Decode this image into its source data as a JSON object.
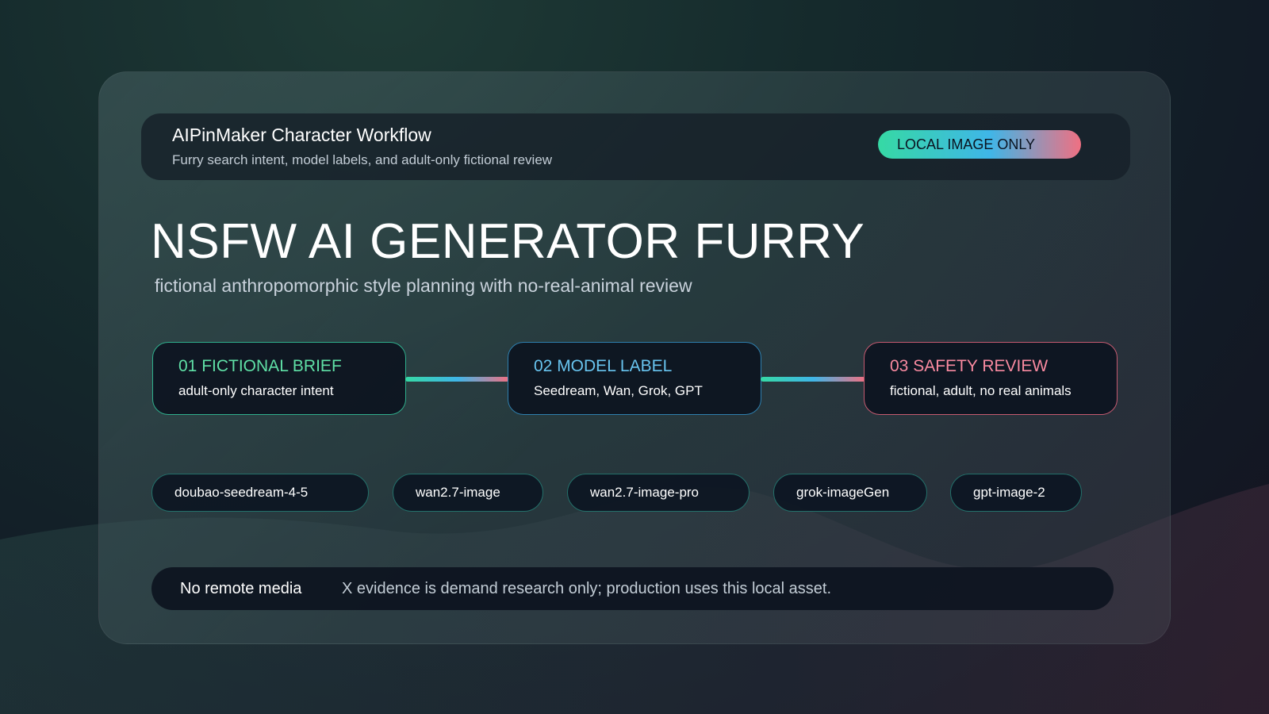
{
  "header": {
    "title": "AIPinMaker Character Workflow",
    "subtitle": "Furry search intent, model labels, and adult-only fictional review",
    "badge": "LOCAL IMAGE ONLY"
  },
  "hero": {
    "title": "NSFW AI GENERATOR FURRY",
    "subtitle": "fictional anthropomorphic style planning with no-real-animal review"
  },
  "steps": [
    {
      "title": "01 FICTIONAL BRIEF",
      "desc": "adult-only character intent"
    },
    {
      "title": "02 MODEL LABEL",
      "desc": "Seedream, Wan, Grok, GPT"
    },
    {
      "title": "03 SAFETY REVIEW",
      "desc": "fictional, adult, no real animals"
    }
  ],
  "models": [
    "doubao-seedream-4-5",
    "wan2.7-image",
    "wan2.7-image-pro",
    "grok-imageGen",
    "gpt-image-2"
  ],
  "footer": {
    "label": "No remote media",
    "text": "X evidence is demand research only; production uses this local asset."
  },
  "colors": {
    "accent_green": "#5fe0a6",
    "accent_blue": "#68c4ef",
    "accent_pink": "#f98aa0",
    "panel_dark": "#0d1420"
  }
}
